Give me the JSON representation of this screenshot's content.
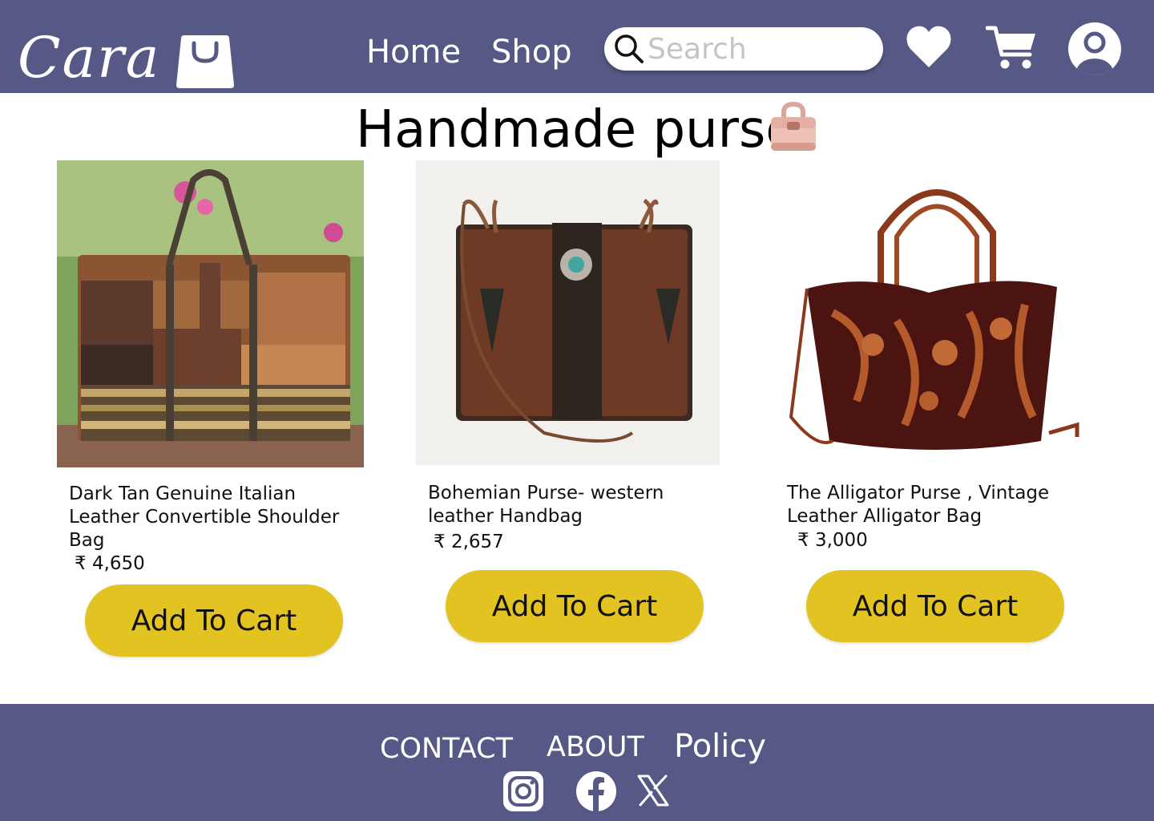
{
  "header": {
    "logo_text": "Cara",
    "nav": {
      "home": "Home",
      "shop": "Shop"
    },
    "search": {
      "placeholder": "Search",
      "value": ""
    },
    "icons": [
      "heart-icon",
      "cart-icon",
      "user-icon"
    ]
  },
  "main": {
    "title": "Handmade purse",
    "products": [
      {
        "name": "Dark Tan Genuine Italian Leather Convertible Shoulder Bag",
        "price": "₹ 4,650",
        "button": "Add To Cart"
      },
      {
        "name": "Bohemian Purse- western leather Handbag",
        "price": "₹ 2,657",
        "button": "Add To Cart"
      },
      {
        "name": "The Alligator Purse , Vintage Leather Alligator Bag",
        "price": "₹ 3,000",
        "button": "Add To Cart"
      }
    ]
  },
  "footer": {
    "links": {
      "contact": "CONTACT",
      "about": "ABOUT",
      "policy": "Policy"
    },
    "social": [
      "instagram-icon",
      "facebook-icon",
      "x-icon"
    ]
  },
  "colors": {
    "brand": "#565886",
    "button": "#e2c322",
    "white": "#ffffff"
  }
}
